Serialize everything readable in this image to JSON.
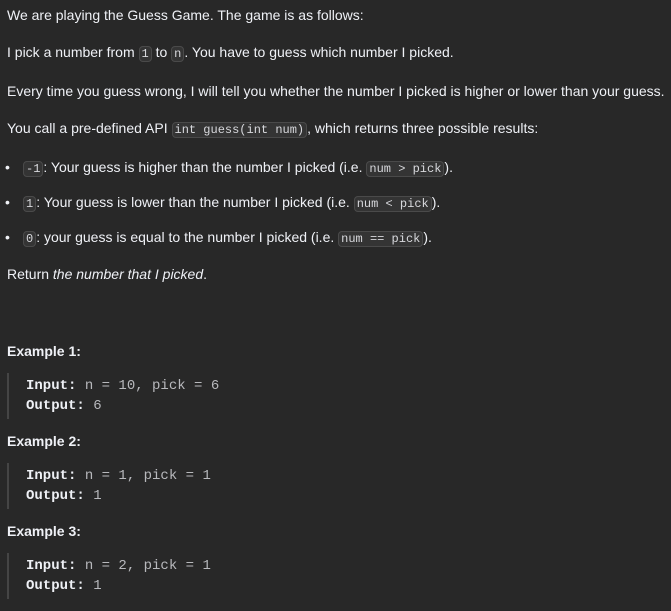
{
  "intro": {
    "line1": "We are playing the Guess Game. The game is as follows:",
    "line2_a": "I pick a number from ",
    "line2_code1": "1",
    "line2_b": " to ",
    "line2_code2": "n",
    "line2_c": ". You have to guess which number I picked.",
    "line3": "Every time you guess wrong, I will tell you whether the number I picked is higher or lower than your guess.",
    "line4_a": "You call a pre-defined API ",
    "line4_code": "int guess(int num)",
    "line4_b": ", which returns three possible results:"
  },
  "results": [
    {
      "code": "-1",
      "text_a": ": Your guess is higher than the number I picked (i.e. ",
      "cond": "num > pick",
      "text_b": ")."
    },
    {
      "code": "1",
      "text_a": ": Your guess is lower than the number I picked (i.e. ",
      "cond": "num < pick",
      "text_b": ")."
    },
    {
      "code": "0",
      "text_a": ": your guess is equal to the number I picked (i.e. ",
      "cond": "num == pick",
      "text_b": ")."
    }
  ],
  "return_line": {
    "a": "Return ",
    "em": "the number that I picked",
    "b": "."
  },
  "examples": [
    {
      "title": "Example 1:",
      "input_label": "Input:",
      "input": " n = 10, pick = 6",
      "output_label": "Output:",
      "output": " 6"
    },
    {
      "title": "Example 2:",
      "input_label": "Input:",
      "input": " n = 1, pick = 1",
      "output_label": "Output:",
      "output": " 1"
    },
    {
      "title": "Example 3:",
      "input_label": "Input:",
      "input": " n = 2, pick = 1",
      "output_label": "Output:",
      "output": " 1"
    }
  ]
}
